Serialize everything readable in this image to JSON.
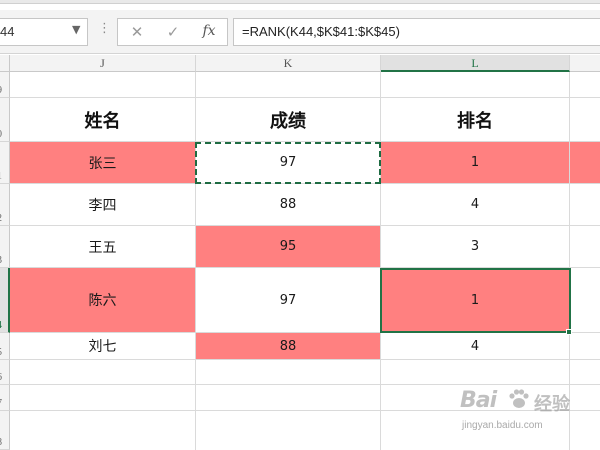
{
  "formula_bar": {
    "name_box": "44",
    "name_box_arrow": "▼",
    "separator": "⋮",
    "cancel_icon": "✕",
    "enter_icon": "✓",
    "fx_label": "fx",
    "formula": "=RANK(K44,$K$41:$K$45)"
  },
  "columns": [
    "J",
    "K",
    "L"
  ],
  "selected_column": "L",
  "rows": [
    {
      "num": "9"
    },
    {
      "num": "0"
    },
    {
      "num": "1"
    },
    {
      "num": "2"
    },
    {
      "num": "3"
    },
    {
      "num": "4"
    },
    {
      "num": "5"
    },
    {
      "num": "6"
    },
    {
      "num": "7"
    },
    {
      "num": "8"
    }
  ],
  "table": {
    "headers": [
      "姓名",
      "成绩",
      "排名"
    ],
    "records": [
      {
        "name": "张三",
        "score": "97",
        "rank": "1"
      },
      {
        "name": "李四",
        "score": "88",
        "rank": "4"
      },
      {
        "name": "王五",
        "score": "95",
        "rank": "3"
      },
      {
        "name": "陈六",
        "score": "97",
        "rank": "1"
      },
      {
        "name": "刘七",
        "score": "88",
        "rank": "4"
      }
    ]
  },
  "colors": {
    "highlight": "#ff8080",
    "selection": "#217346"
  },
  "watermark": {
    "main": "Bai",
    "paw_icon": "baidu-paw-icon",
    "suffix": "经验",
    "sub": "jingyan.baidu.com"
  }
}
